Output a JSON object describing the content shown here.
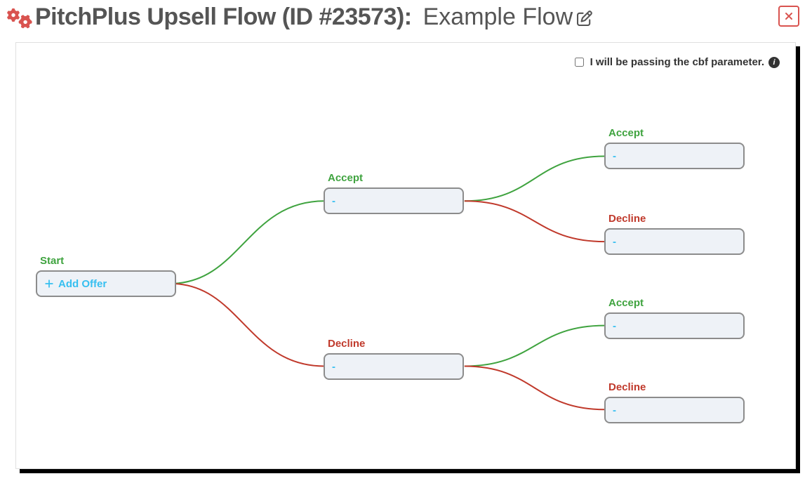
{
  "header": {
    "title": "PitchPlus Upsell Flow (ID #23573):",
    "flow_name": "Example Flow"
  },
  "cbf": {
    "label": "I will be passing the cbf parameter.",
    "checked": false
  },
  "colors": {
    "accept": "#3fa33f",
    "decline": "#c0392b",
    "accent": "#d9534f",
    "link": "#36bff0"
  },
  "nodes": {
    "start": {
      "label": "Start",
      "button": "Add Offer"
    },
    "level1": {
      "accept": {
        "label": "Accept",
        "value": "-"
      },
      "decline": {
        "label": "Decline",
        "value": "-"
      }
    },
    "level2": {
      "accept_accept": {
        "label": "Accept",
        "value": "-"
      },
      "accept_decline": {
        "label": "Decline",
        "value": "-"
      },
      "decline_accept": {
        "label": "Accept",
        "value": "-"
      },
      "decline_decline": {
        "label": "Decline",
        "value": "-"
      }
    }
  }
}
